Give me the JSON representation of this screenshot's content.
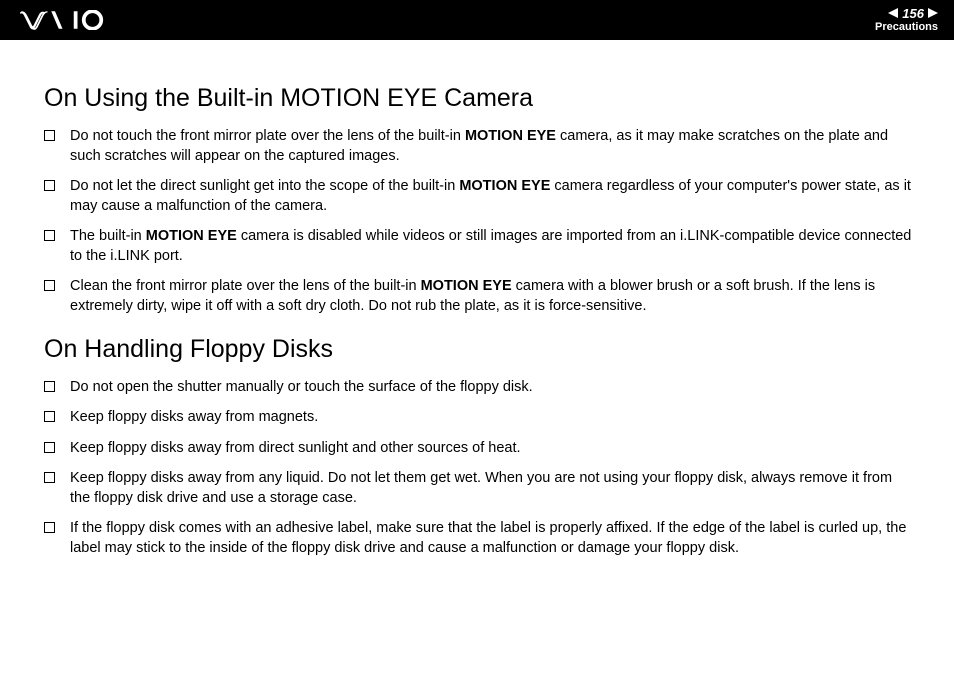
{
  "header": {
    "page_number": "156",
    "section": "Precautions"
  },
  "section1": {
    "heading": "On Using the Built-in MOTION EYE Camera",
    "items": [
      {
        "pre": "Do not touch the front mirror plate over the lens of the built-in ",
        "bold": "MOTION EYE",
        "post": " camera, as it may make scratches on the plate and such scratches will appear on the captured images."
      },
      {
        "pre": "Do not let the direct sunlight get into the scope of the built-in ",
        "bold": "MOTION EYE",
        "post": " camera regardless of your computer's power state, as it may cause a malfunction of the camera."
      },
      {
        "pre": "The built-in ",
        "bold": "MOTION EYE",
        "post": " camera is disabled while videos or still images are imported from an i.LINK-compatible device connected to the i.LINK port."
      },
      {
        "pre": "Clean the front mirror plate over the lens of the built-in ",
        "bold": "MOTION EYE",
        "post": " camera with a blower brush or a soft brush. If the lens is extremely dirty, wipe it off with a soft dry cloth. Do not rub the plate, as it is force-sensitive."
      }
    ]
  },
  "section2": {
    "heading": "On Handling Floppy Disks",
    "items": [
      {
        "text": "Do not open the shutter manually or touch the surface of the floppy disk."
      },
      {
        "text": "Keep floppy disks away from magnets."
      },
      {
        "text": "Keep floppy disks away from direct sunlight and other sources of heat."
      },
      {
        "text": "Keep floppy disks away from any liquid. Do not let them get wet. When you are not using your floppy disk, always remove it from the floppy disk drive and use a storage case."
      },
      {
        "text": "If the floppy disk comes with an adhesive label, make sure that the label is properly affixed. If the edge of the label is curled up, the label may stick to the inside of the floppy disk drive and cause a malfunction or damage your floppy disk."
      }
    ]
  }
}
